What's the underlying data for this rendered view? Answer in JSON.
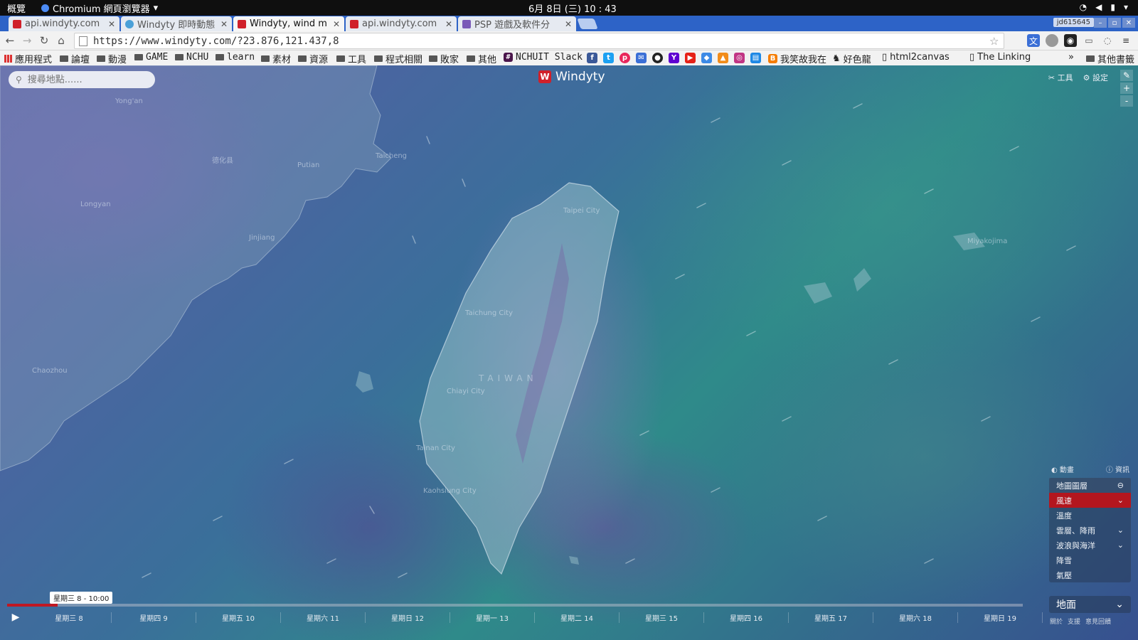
{
  "system": {
    "overview": "概覽",
    "app_name": "Chromium 網頁瀏覽器",
    "clock": "6月 8日 (三) 10 : 43"
  },
  "tabs": [
    {
      "title": "api.windyty.com",
      "color": "#d0202a"
    },
    {
      "title": "Windyty 即時動態",
      "color": "#4aa0d8"
    },
    {
      "title": "Windyty, wind m",
      "color": "#d0202a"
    },
    {
      "title": "api.windyty.com",
      "color": "#d0202a"
    },
    {
      "title": "PSP 遊戲及軟件分",
      "color": "#7a5ab8"
    }
  ],
  "profile": "jd615645",
  "address": {
    "url": "https://www.windyty.com/?23.876,121.437,8"
  },
  "bookmarks": [
    "應用程式",
    "論壇",
    "動漫",
    "GAME",
    "NCHU",
    "learn",
    "素材",
    "資源",
    "工具",
    "程式相關",
    "敗家",
    "其他",
    "NCHUIT Slack",
    "我笑故我在",
    "好色龍",
    "html2canvas",
    "The Linking",
    "其他書籤"
  ],
  "map": {
    "search_placeholder": "搜尋地點......",
    "brand": "Windyty",
    "tools": "工具",
    "settings": "設定",
    "zoom_in": "+",
    "zoom_out": "-",
    "labels": {
      "yongan": "Yong'an",
      "dehua": "德化县",
      "putian": "Putian",
      "taicheng": "Taicheng",
      "longyan": "Longyan",
      "jinjiang": "Jinjiang",
      "chaozhou": "Chaozhou",
      "taipei": "Taipei City",
      "taichung": "Taichung City",
      "chiayi": "Chiayi City",
      "tainan": "Tainan City",
      "kaohsiung": "Kaohsiung City",
      "miyako": "Miyakojima",
      "taiwan": "TAIWAN"
    }
  },
  "panel": {
    "animation": "動畫",
    "info": "資訊",
    "layers_title": "地圖圖層",
    "layers": [
      "風速",
      "溫度",
      "雲層、降雨",
      "波浪與海洋",
      "降雪",
      "氣壓"
    ],
    "selected_index": 0,
    "ground": "地面",
    "footer": [
      "關於",
      "支援",
      "意見回饋"
    ]
  },
  "timeline": {
    "current": "星期三 8 - 10:00",
    "progress": 0.05,
    "days": [
      "星期三 8",
      "星期四 9",
      "星期五 10",
      "星期六 11",
      "星期日 12",
      "星期一 13",
      "星期二 14",
      "星期三 15",
      "星期四 16",
      "星期五 17",
      "星期六 18",
      "星期日 19"
    ]
  }
}
